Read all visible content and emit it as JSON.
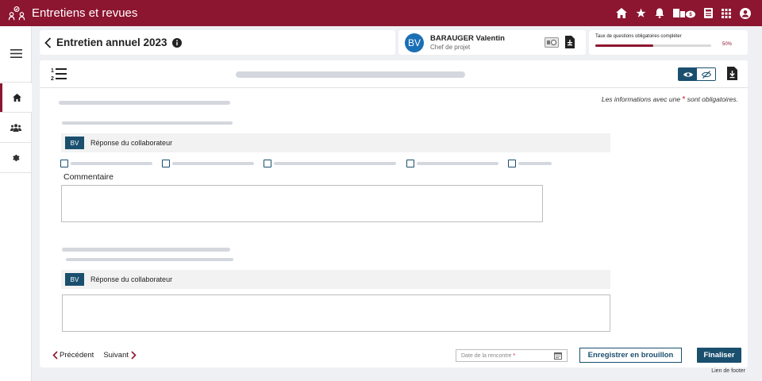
{
  "app": {
    "title": "Entretiens et revues",
    "header_icons": [
      "home-icon",
      "star-icon",
      "bell-icon",
      "org-badge-icon",
      "calculator-icon",
      "grid-icon",
      "account-icon"
    ]
  },
  "sidebar": {
    "items": [
      {
        "name": "menu",
        "icon": "hamburger-icon"
      },
      {
        "name": "home",
        "icon": "home-icon",
        "active": true
      },
      {
        "name": "team",
        "icon": "team-icon"
      },
      {
        "name": "settings",
        "icon": "gear-icon"
      }
    ]
  },
  "review": {
    "title": "Entretien annuel 2023"
  },
  "user": {
    "initials": "BV",
    "name": "BARAUGER Valentin",
    "role": "Chef de projet"
  },
  "progress": {
    "label": "Taux de questions obligatoires compléter",
    "value": 0.5,
    "text": "50%"
  },
  "form": {
    "mandatory_prefix": "Les informations avec une",
    "mandatory_star": "*",
    "mandatory_suffix": "sont obligatoires.",
    "sections": [
      {
        "tag": "BV",
        "response_label": "Réponse du collaborateur",
        "comment_label": "Commentaire"
      },
      {
        "tag": "BV",
        "response_label": "Réponse du collaborateur"
      }
    ]
  },
  "footer": {
    "prev_label": "Précédent",
    "next_label": "Suivant",
    "date_placeholder": "Date de la rencontre",
    "date_star": "*",
    "draft_button": "Enregistrer en brouillon",
    "final_button": "Finaliser",
    "footer_link": "Lien de footer"
  },
  "colors": {
    "brand": "#8c1530",
    "accent": "#1a4f6e",
    "avatar": "#1a6fb5"
  }
}
